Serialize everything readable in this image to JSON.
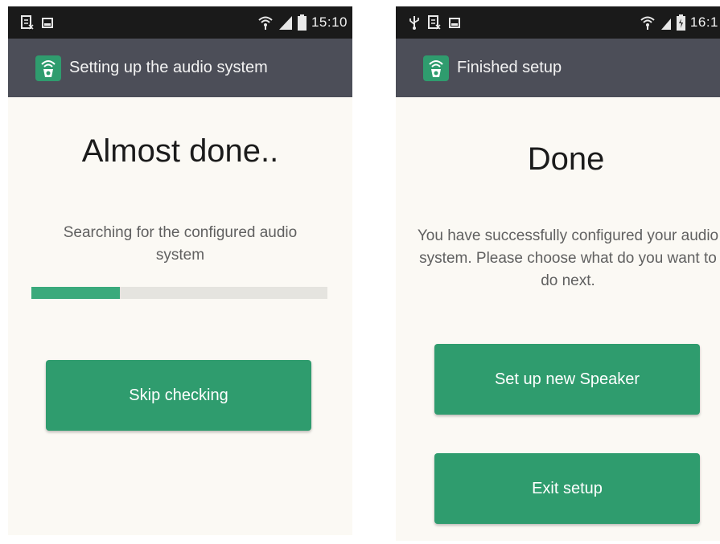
{
  "left_screen": {
    "status_bar": {
      "time": "15:10"
    },
    "action_bar": {
      "title": "Setting up the audio system"
    },
    "heading": "Almost done..",
    "message": "Searching for the configured audio system",
    "progress": {
      "fraction": 0.3
    },
    "skip_button": "Skip checking"
  },
  "right_screen": {
    "status_bar": {
      "time": "16:1"
    },
    "action_bar": {
      "title": "Finished setup"
    },
    "heading": "Done",
    "message": "You have successfully configured your audio system. Please choose what do you want to do next.",
    "setup_button": "Set up new Speaker",
    "exit_button": "Exit setup"
  },
  "colors": {
    "accent_green": "#2f9c6e",
    "progress_green": "#3aaa7c",
    "action_bar": "#4c4e58",
    "status_bar": "#1a1a1a",
    "background": "#fbf9f4"
  },
  "icons": {
    "app": "speaker-app-icon",
    "notification": "notification-icon",
    "image": "image-icon",
    "usb": "usb-icon",
    "wifi": "wifi-icon",
    "signal": "signal-icon",
    "battery": "battery-icon"
  }
}
